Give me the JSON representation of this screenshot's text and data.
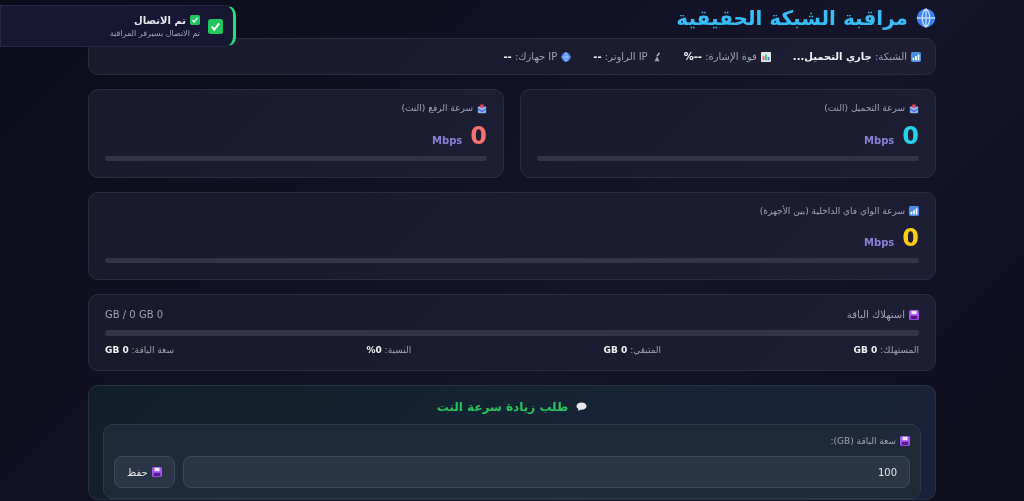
{
  "toast": {
    "title": "تم الاتصال",
    "message": "تم الاتصال بسيرفر المراقبة"
  },
  "title": "مراقبة الشبكة الحقيقية",
  "info": [
    {
      "text": "الشبكة: **جاري التحميل...**"
    },
    {
      "text": "قوة الإشارة: **--%**"
    },
    {
      "text": "IP الراوتر: **--**"
    },
    {
      "text": "IP جهازك: **--**"
    }
  ],
  "speeds": [
    {
      "label": "سرعة التحميل (النت)",
      "value": "0",
      "unit": "Mbps",
      "color": "#22d3ee",
      "level": 0
    },
    {
      "label": "سرعة الرفع (النت)",
      "value": "0",
      "unit": "Mbps",
      "color": "#f87171",
      "level": 0
    },
    {
      "label": "سرعة الواي فاي الداخلية (بين الأجهزة)",
      "value": "0",
      "unit": "Mbps",
      "color": "#facc15",
      "level": 0
    }
  ],
  "usage": {
    "title": "استهلاك الباقة",
    "total": "0 GB / 0 GB",
    "level": 0,
    "stats": [
      "المستهلك: **0 GB**",
      "المتبقي: **0 GB**",
      "النسبة: **0%**",
      "سعة الباقة: **0 GB**"
    ]
  },
  "request": {
    "title": "طلب زيادة سرعة النت",
    "field_label": "سعة الباقة (GB):",
    "value": "100",
    "button": "حفظ"
  }
}
